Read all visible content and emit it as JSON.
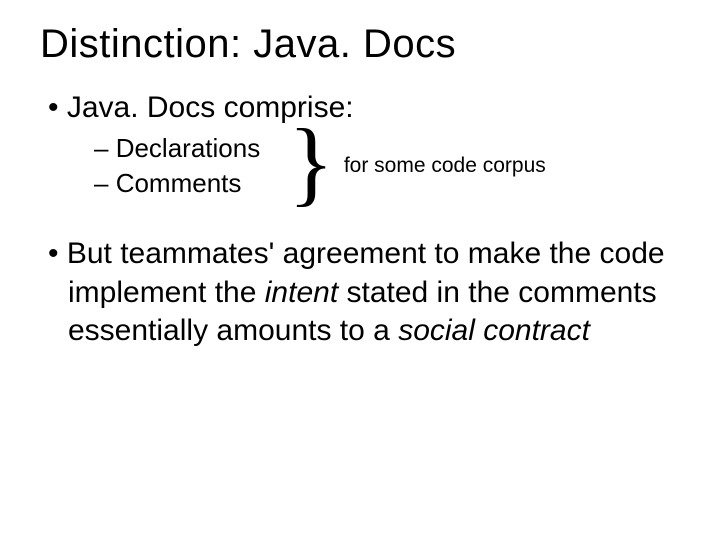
{
  "title": "Distinction:  Java. Docs",
  "bullet1": "Java. Docs comprise:",
  "sub1": "Declarations",
  "sub2": "Comments",
  "brace": "}",
  "annotation": "for some code corpus",
  "b2a": "But teammates' agreement to make the code implement the ",
  "b2b": "intent",
  "b2c": " stated in the comments essentially amounts to a ",
  "b2d": "social contract"
}
